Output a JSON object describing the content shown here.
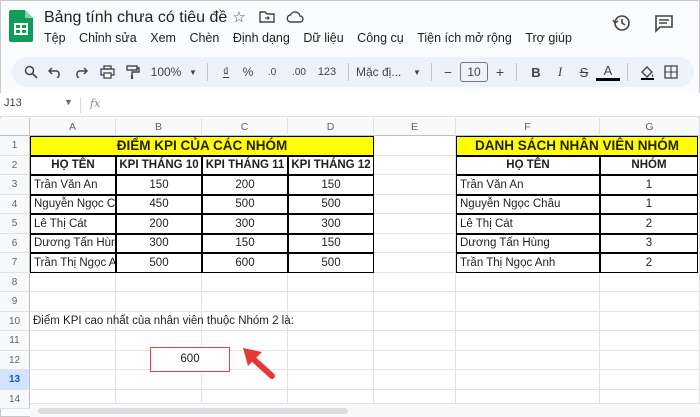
{
  "app": {
    "title": "Bảng tính chưa có tiêu đề",
    "menu": [
      "Tệp",
      "Chỉnh sửa",
      "Xem",
      "Chèn",
      "Định dạng",
      "Dữ liệu",
      "Công cụ",
      "Tiện ích mở rộng",
      "Trợ giúp"
    ]
  },
  "toolbar": {
    "zoom": "100%",
    "currency": "₫",
    "percent": "%",
    "decimal_decrease": ".0",
    "decimal_increase": ".00",
    "number_format": "123",
    "font": "Mặc đị...",
    "font_size": "10",
    "minus": "−",
    "plus": "+",
    "bold": "B",
    "italic": "I",
    "strikethrough": "S",
    "text_color": "A"
  },
  "formula": {
    "cell_ref": "J13",
    "fx": "fx"
  },
  "sheet": {
    "columns": [
      "A",
      "B",
      "C",
      "D",
      "E",
      "F",
      "G"
    ],
    "rows": [
      "1",
      "2",
      "3",
      "4",
      "5",
      "6",
      "7",
      "8",
      "9",
      "10",
      "11",
      "12",
      "13",
      "14"
    ],
    "selected_row": "13",
    "kpi_table": {
      "title": "ĐIỂM KPI CỦA CÁC NHÓM",
      "headers": [
        "HỌ TÊN",
        "KPI THÁNG 10",
        "KPI THÁNG 11",
        "KPI THÁNG 12"
      ],
      "rows": [
        [
          "Trần Văn An",
          "150",
          "200",
          "150"
        ],
        [
          "Nguyễn Ngọc Ch",
          "450",
          "500",
          "500"
        ],
        [
          "Lê Thị Cát",
          "200",
          "300",
          "300"
        ],
        [
          "Dương Tấn Hùng",
          "300",
          "150",
          "150"
        ],
        [
          "Trần Thị Ngọc An",
          "500",
          "600",
          "500"
        ]
      ]
    },
    "staff_table": {
      "title": "DANH SÁCH NHÂN VIÊN NHÓM",
      "headers": [
        "HỌ TÊN",
        "NHÓM"
      ],
      "rows": [
        [
          "Trần Văn An",
          "1"
        ],
        [
          "Nguyễn Ngọc Châu",
          "1"
        ],
        [
          "Lê Thị Cát",
          "2"
        ],
        [
          "Dương Tấn Hùng",
          "3"
        ],
        [
          "Trần Thị Ngọc Anh",
          "2"
        ]
      ]
    },
    "question": "Điểm KPI cao nhất của nhân viên thuộc Nhóm 2 là:",
    "answer": "600"
  },
  "colors": {
    "header_yellow": "#ffff00",
    "highlight_red": "#e0433a",
    "sheets_green": "#0f9d58"
  }
}
